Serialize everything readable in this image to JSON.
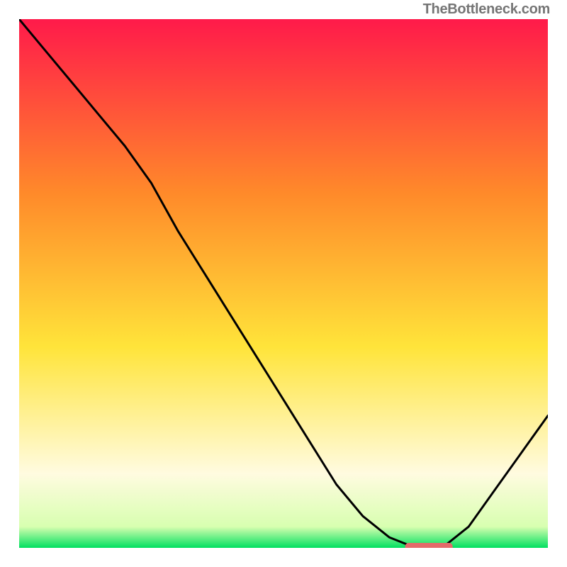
{
  "attribution": "TheBottleneck.com",
  "colors": {
    "gradient_top": "#ff1a4a",
    "gradient_mid_orange": "#ff8a2a",
    "gradient_mid_yellow": "#ffe43a",
    "gradient_pale": "#fffbe0",
    "gradient_green": "#00e060",
    "curve": "#000000",
    "marker": "#e46a6a"
  },
  "chart_data": {
    "type": "line",
    "title": "",
    "xlabel": "",
    "ylabel": "",
    "xlim": [
      0,
      100
    ],
    "ylim": [
      0,
      100
    ],
    "x": [
      0,
      5,
      10,
      15,
      20,
      25,
      30,
      35,
      40,
      45,
      50,
      55,
      60,
      65,
      70,
      75,
      80,
      85,
      90,
      95,
      100
    ],
    "values": [
      100,
      94,
      88,
      82,
      76,
      69,
      60,
      52,
      44,
      36,
      28,
      20,
      12,
      6,
      2,
      0,
      0,
      4,
      11,
      18,
      25
    ],
    "optimum_marker": {
      "x_start": 73,
      "x_end": 82,
      "y": 0
    }
  }
}
